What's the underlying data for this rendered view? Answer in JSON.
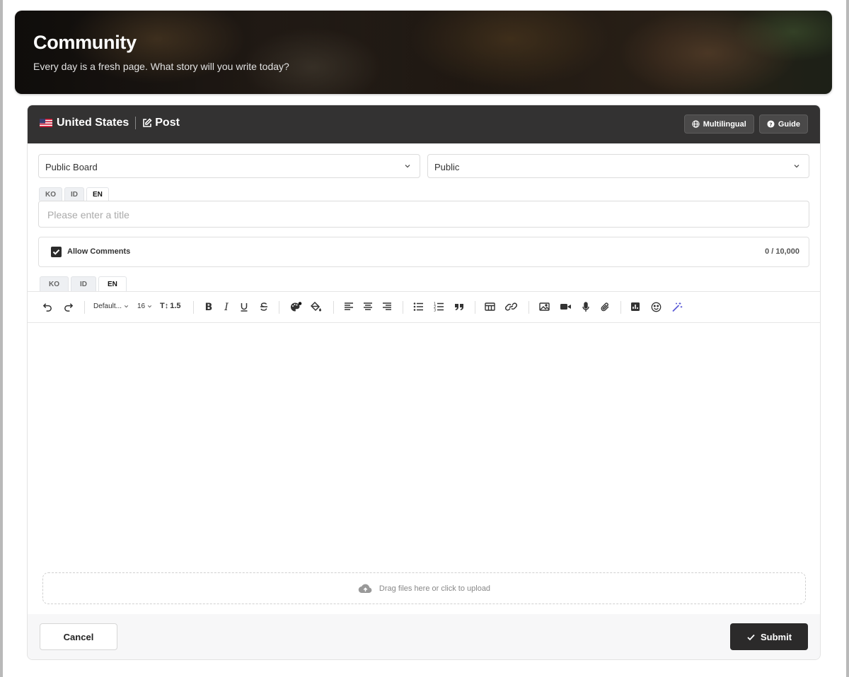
{
  "hero": {
    "title": "Community",
    "subtitle": "Every day is a fresh page. What story will you write today?"
  },
  "card_header": {
    "country": "United States",
    "post_label": "Post",
    "multilingual_label": "Multilingual",
    "guide_label": "Guide"
  },
  "form": {
    "board_select": "Public Board",
    "visibility_select": "Public",
    "title_tabs": [
      "KO",
      "ID",
      "EN"
    ],
    "title_active_tab": "EN",
    "title_placeholder": "Please enter a title",
    "allow_comments_label": "Allow Comments",
    "allow_comments_checked": true,
    "char_counter": "0 / 10,000",
    "editor_tabs": [
      "KO",
      "ID",
      "EN"
    ],
    "editor_active_tab": "EN"
  },
  "toolbar": {
    "font_family": "Default...",
    "font_size": "16",
    "line_height": "1.5",
    "tools": [
      "undo-icon",
      "redo-icon",
      "bold-icon",
      "italic-icon",
      "underline-icon",
      "strikethrough-icon",
      "text-color-icon",
      "highlight-icon",
      "align-left-icon",
      "align-center-icon",
      "align-right-icon",
      "bullet-list-icon",
      "numbered-list-icon",
      "quote-icon",
      "table-icon",
      "link-icon",
      "image-icon",
      "video-icon",
      "microphone-icon",
      "attachment-icon",
      "chart-icon",
      "emoji-icon",
      "magic-wand-icon"
    ]
  },
  "dropzone": {
    "label": "Drag files here or click to upload"
  },
  "footer": {
    "cancel_label": "Cancel",
    "submit_label": "Submit"
  },
  "colors": {
    "header_bg": "#333232",
    "submit_bg": "#2b2a2a",
    "accent": "#5b5bd6"
  }
}
